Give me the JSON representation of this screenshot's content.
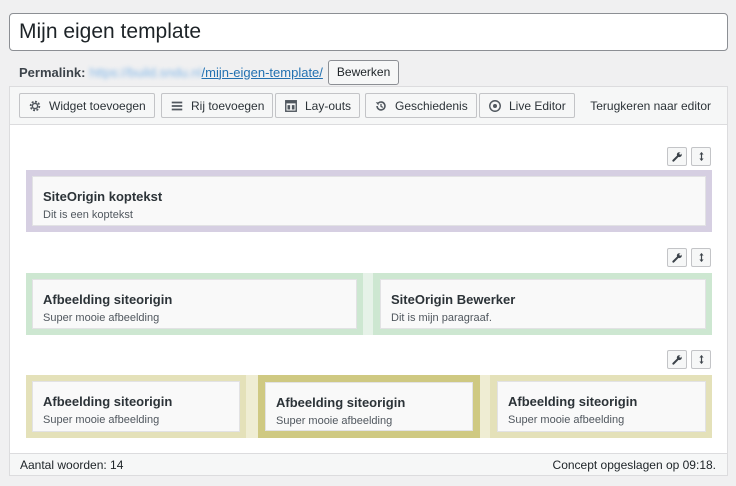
{
  "title": {
    "value": "Mijn eigen template"
  },
  "permalink": {
    "label": "Permalink:",
    "base_url": "https://build.sndu.nl",
    "slug": "/mijn-eigen-template/",
    "edit_label": "Bewerken"
  },
  "toolbar": {
    "widget_label": "Widget toevoegen",
    "row_label": "Rij toevoegen",
    "layouts_label": "Lay-outs",
    "history_label": "Geschiedenis",
    "live_label": "Live Editor",
    "back_label": "Terugkeren naar editor"
  },
  "rows": [
    {
      "cells": [
        {
          "title": "SiteOrigin koptekst",
          "desc": "Dit is een koptekst"
        }
      ]
    },
    {
      "cells": [
        {
          "title": "Afbeelding siteorigin",
          "desc": "Super mooie afbeelding"
        },
        {
          "title": "SiteOrigin Bewerker",
          "desc": "Dit is mijn paragraaf."
        }
      ]
    },
    {
      "cells": [
        {
          "title": "Afbeelding siteorigin",
          "desc": "Super mooie afbeelding"
        },
        {
          "title": "Afbeelding siteorigin",
          "desc": "Super mooie afbeelding"
        },
        {
          "title": "Afbeelding siteorigin",
          "desc": "Super mooie afbeelding"
        }
      ]
    }
  ],
  "status": {
    "word_count": "Aantal woorden: 14",
    "saved": "Concept opgeslagen op 09:18."
  },
  "colors": {
    "row1": "#d6cfe2",
    "row2": "#cde7d1",
    "row3": "#e4e1b9",
    "row3_active": "#cfc982"
  }
}
